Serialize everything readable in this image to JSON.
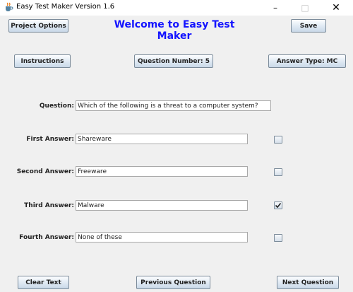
{
  "window": {
    "title": "Easy Test Maker Version 1.6",
    "minimize": "–",
    "maximize": "□",
    "close": "✕"
  },
  "header": {
    "project_options": "Project Options",
    "title": "Welcome to Easy Test Maker",
    "save": "Save"
  },
  "toolbar": {
    "instructions": "Instructions",
    "question_number": "Question Number: 5",
    "answer_type": "Answer Type: MC"
  },
  "question": {
    "label": "Question:",
    "value": "Which of the following is a threat to a computer system?"
  },
  "answers": [
    {
      "label": "First Answer:",
      "value": "Shareware",
      "checked": false
    },
    {
      "label": "Second Answer:",
      "value": "Freeware",
      "checked": false
    },
    {
      "label": "Third Answer:",
      "value": "Malware",
      "checked": true
    },
    {
      "label": "Fourth Answer:",
      "value": "None of these",
      "checked": false
    }
  ],
  "footer": {
    "clear_text": "Clear Text",
    "previous_question": "Previous Question",
    "next_question": "Next Question"
  },
  "colors": {
    "title_blue": "#1414ff",
    "background": "#f0f0f0"
  },
  "icons": {
    "app": "java-cup-icon",
    "check": "checkmark-icon"
  }
}
